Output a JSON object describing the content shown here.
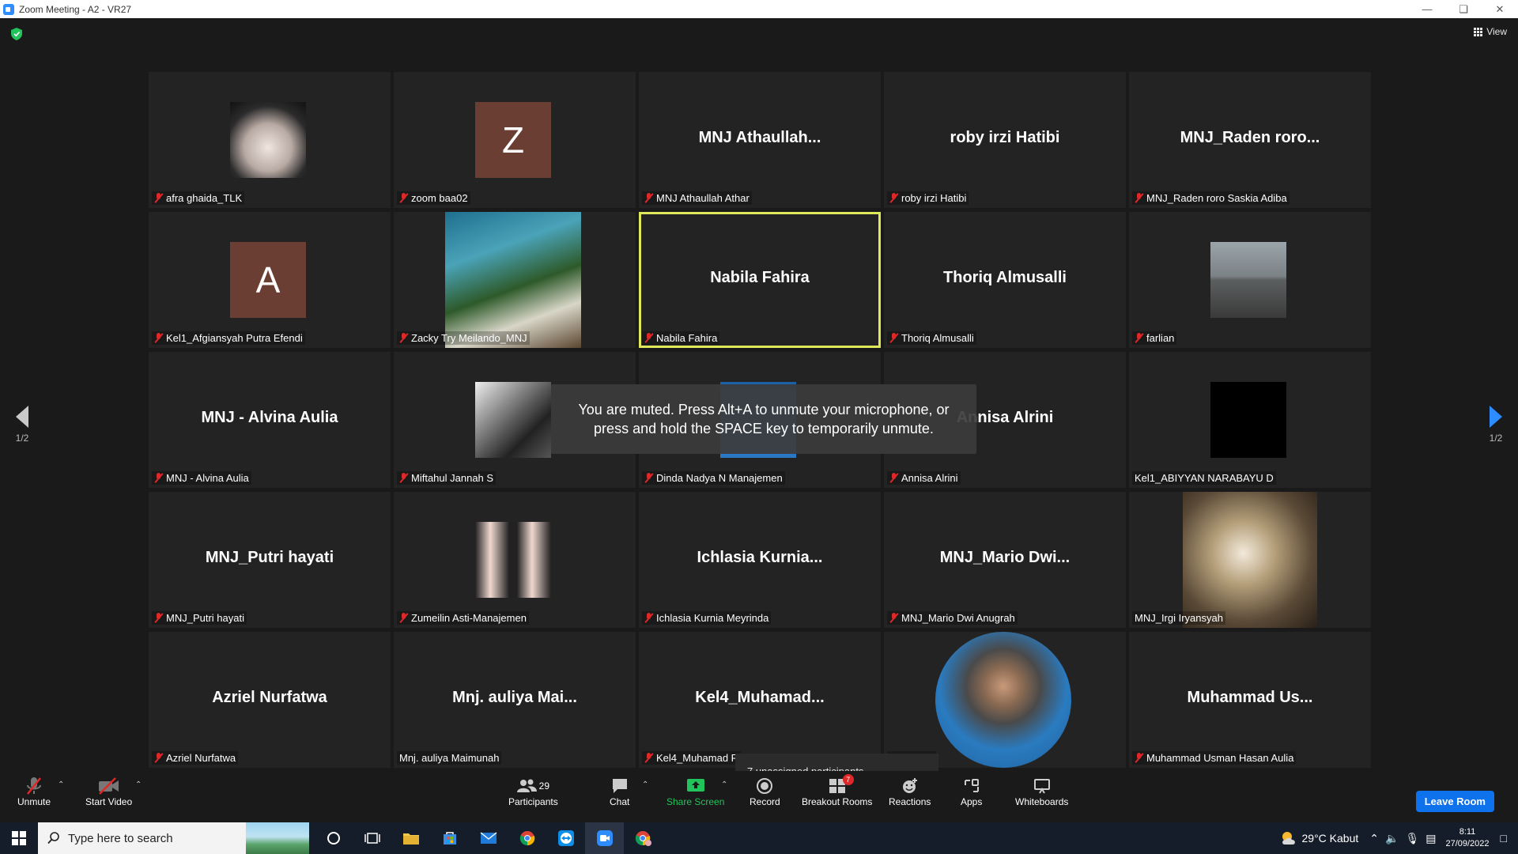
{
  "window": {
    "title": "Zoom Meeting - A2 - VR27"
  },
  "header": {
    "view_label": "View"
  },
  "pagination": {
    "left": "1/2",
    "right": "1/2"
  },
  "participants": [
    {
      "big": "",
      "label": "afra ghaida_TLK",
      "muted": true,
      "media": "photo-boy"
    },
    {
      "big": "",
      "label": "zoom baa02",
      "muted": true,
      "media": "letter",
      "letter": "Z"
    },
    {
      "big": "MNJ  Athaullah...",
      "label": "MNJ Athaullah Athar",
      "muted": true
    },
    {
      "big": "roby irzi Hatibi",
      "label": "roby irzi Hatibi",
      "muted": true
    },
    {
      "big": "MNJ_Raden  roro...",
      "label": "MNJ_Raden roro Saskia Adiba",
      "muted": true
    },
    {
      "big": "",
      "label": "Kel1_Afgiansyah Putra Efendi",
      "muted": true,
      "media": "letter",
      "letter": "A"
    },
    {
      "big": "",
      "label": "Zacky Try Meilando_MNJ",
      "muted": true,
      "media": "photo-cliff"
    },
    {
      "big": "Nabila Fahira",
      "label": "Nabila Fahira",
      "muted": true,
      "active": true
    },
    {
      "big": "Thoriq Almusalli",
      "label": "Thoriq Almusalli",
      "muted": true
    },
    {
      "big": "",
      "label": "farlian",
      "muted": true,
      "media": "photo-street"
    },
    {
      "big": "MNJ - Alvina Aulia",
      "label": "MNJ - Alvina Aulia",
      "muted": true
    },
    {
      "big": "",
      "label": "Miftahul Jannah S",
      "muted": true,
      "media": "photo-bw"
    },
    {
      "big": "",
      "label": "Dinda Nadya N Manajemen",
      "muted": true,
      "media": "photo-blue"
    },
    {
      "big": "Annisa Alrini",
      "label": "Annisa Alrini",
      "muted": true
    },
    {
      "big": "",
      "label": "Kel1_ABIYYAN NARABAYU D",
      "muted": false,
      "media": "photo-black"
    },
    {
      "big": "MNJ_Putri hayati",
      "label": "MNJ_Putri hayati",
      "muted": true
    },
    {
      "big": "",
      "label": "Zumeilin Asti-Manajemen",
      "muted": true,
      "media": "photo-girls"
    },
    {
      "big": "Ichlasia  Kurnia...",
      "label": "Ichlasia Kurnia Meyrinda",
      "muted": true
    },
    {
      "big": "MNJ_Mario  Dwi...",
      "label": "MNJ_Mario Dwi Anugrah",
      "muted": true
    },
    {
      "big": "",
      "label": "MNJ_Irgi Iryansyah",
      "muted": false,
      "media": "photo-car"
    },
    {
      "big": "Azriel Nurfatwa",
      "label": "Azriel Nurfatwa",
      "muted": true
    },
    {
      "big": "Mnj. auliya  Mai...",
      "label": "Mnj. auliya Maimunah",
      "muted": false
    },
    {
      "big": "Kel4_Muhamad...",
      "label": "Kel4_Muhamad R",
      "muted": true
    },
    {
      "big": "",
      "label": "i Rahman",
      "muted": false,
      "media": "photo-man"
    },
    {
      "big": "Muhammad  Us...",
      "label": "Muhammad Usman Hasan Aulia",
      "muted": true
    }
  ],
  "toast": {
    "text": "You are muted. Press Alt+A to unmute your microphone, or press and hold the SPACE key to temporarily unmute."
  },
  "tooltip": {
    "text": "7 unassigned participants"
  },
  "toolbar": {
    "unmute": "Unmute",
    "start_video": "Start Video",
    "participants": "Participants",
    "participants_count": "29",
    "chat": "Chat",
    "share_screen": "Share Screen",
    "record": "Record",
    "breakout_rooms": "Breakout Rooms",
    "breakout_badge": "7",
    "reactions": "Reactions",
    "apps": "Apps",
    "whiteboards": "Whiteboards",
    "leave": "Leave Room"
  },
  "taskbar": {
    "search_placeholder": "Type here to search",
    "weather": "29°C  Kabut",
    "time": "8:11",
    "date": "27/09/2022"
  },
  "colors": {
    "accent": "#0e72ed",
    "active_border": "#dfe85a",
    "muted_red": "#e02828",
    "share_green": "#21c45a"
  }
}
